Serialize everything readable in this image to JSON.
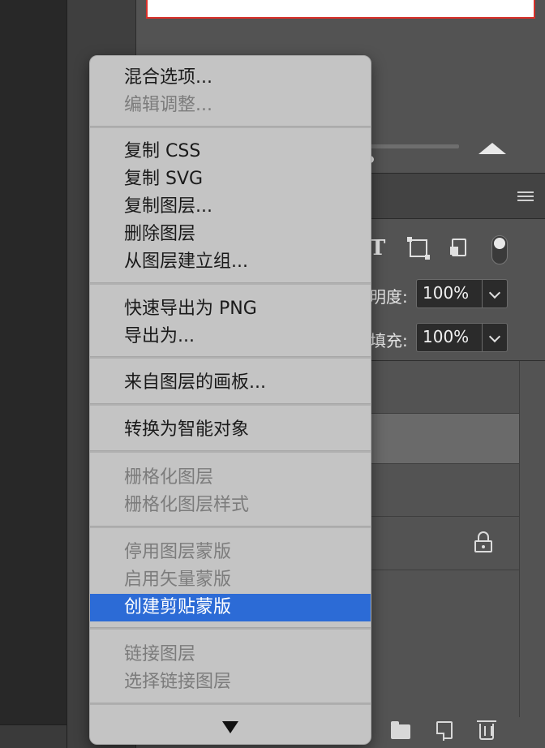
{
  "properties": {
    "opacity_label": "明度:",
    "opacity_value": "100%",
    "fill_label": "填充:",
    "fill_value": "100%"
  },
  "filter_icons": [
    "text-filter-icon",
    "shape-filter-icon",
    "smart-object-filter-icon"
  ],
  "context_menu": {
    "items": [
      {
        "label": "混合选项...",
        "enabled": true
      },
      {
        "label": "编辑调整...",
        "enabled": false
      },
      {
        "label": "复制 CSS",
        "enabled": true
      },
      {
        "label": "复制 SVG",
        "enabled": true
      },
      {
        "label": "复制图层...",
        "enabled": true
      },
      {
        "label": "删除图层",
        "enabled": true
      },
      {
        "label": "从图层建立组...",
        "enabled": true
      },
      {
        "label": "快速导出为 PNG",
        "enabled": true
      },
      {
        "label": "导出为...",
        "enabled": true
      },
      {
        "label": "来自图层的画板...",
        "enabled": true
      },
      {
        "label": "转换为智能对象",
        "enabled": true
      },
      {
        "label": "栅格化图层",
        "enabled": false
      },
      {
        "label": "栅格化图层样式",
        "enabled": false
      },
      {
        "label": "停用图层蒙版",
        "enabled": false
      },
      {
        "label": "启用矢量蒙版",
        "enabled": false
      },
      {
        "label": "创建剪贴蒙版",
        "enabled": true,
        "highlighted": true
      },
      {
        "label": "链接图层",
        "enabled": false
      },
      {
        "label": "选择链接图层",
        "enabled": false
      }
    ]
  },
  "colors": {
    "highlight": "#2c6bd6",
    "menu_bg": "#c4c4c4",
    "panel_bg": "#535353",
    "canvas_border": "#d9302a"
  }
}
